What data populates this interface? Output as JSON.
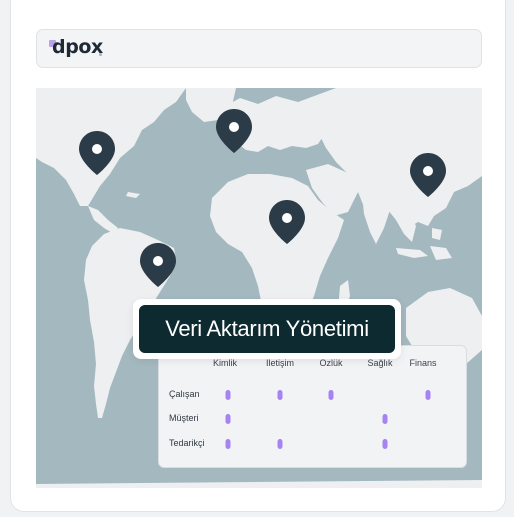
{
  "brand": {
    "name": "dpox",
    "accent": "#b9a3e6"
  },
  "banner": {
    "title": "Veri Aktarım Yönetimi"
  },
  "matrix": {
    "columns": [
      "Kimlik",
      "İletişim",
      "Özlük",
      "Sağlık",
      "Finans"
    ],
    "rows": [
      {
        "label": "Çalışan",
        "flags": [
          true,
          true,
          true,
          false,
          true
        ]
      },
      {
        "label": "Müşteri",
        "flags": [
          true,
          false,
          false,
          true,
          false
        ]
      },
      {
        "label": "Tedarikçi",
        "flags": [
          true,
          true,
          false,
          true,
          false
        ]
      }
    ]
  },
  "map": {
    "ocean_color": "#a4b8c0",
    "land_color": "#eeeff1",
    "pin_color": "#2b3b47",
    "pins": [
      "north-america",
      "europe",
      "east-asia",
      "east-africa",
      "south-america"
    ]
  }
}
